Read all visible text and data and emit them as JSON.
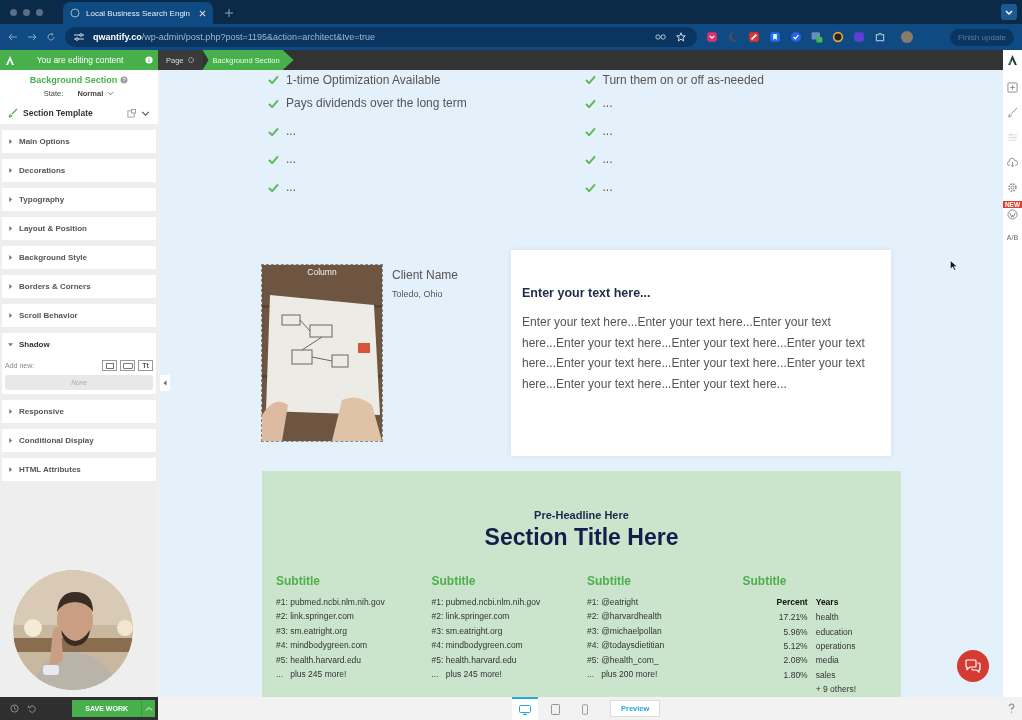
{
  "browser": {
    "tab_title": "Local Business Search Engin",
    "url_domain": "qwantify.co",
    "url_path": "/wp-admin/post.php?post=1195&action=architect&tve=true",
    "finish_update": "Finish update"
  },
  "editor_bar": {
    "notice": "You are editing content",
    "breadcrumbs": [
      "Page",
      "Background Section"
    ]
  },
  "sidebar": {
    "title": "Background Section",
    "state_label": "State:",
    "state_value": "Normal",
    "template": "Section Template",
    "panels": [
      {
        "label": "Main Options",
        "expanded": false
      },
      {
        "label": "Decorations",
        "expanded": false
      },
      {
        "label": "Typography",
        "expanded": false
      },
      {
        "label": "Layout & Position",
        "expanded": false
      },
      {
        "label": "Background Style",
        "expanded": false
      },
      {
        "label": "Borders & Corners",
        "expanded": false
      },
      {
        "label": "Scroll Behavior",
        "expanded": false
      },
      {
        "label": "Shadow",
        "expanded": true,
        "add_new": "Add new:",
        "empty": "None",
        "type_button": "Tt"
      },
      {
        "label": "Responsive",
        "expanded": false
      },
      {
        "label": "Conditional Display",
        "expanded": false
      },
      {
        "label": "HTML Attributes",
        "expanded": false
      }
    ]
  },
  "checklist": {
    "columns": [
      [
        "1-time Optimization Available",
        "Pays dividends over the long term",
        "...",
        "...",
        "..."
      ],
      [
        "Turn them on or off as-needed",
        "...",
        "...",
        "...",
        "..."
      ]
    ]
  },
  "testimonial": {
    "photo_label": "Column",
    "client_name": "Client Name",
    "location": "Toledo, Ohio",
    "heading": "Enter your text here...",
    "body": "Enter your text here...Enter your text here...Enter your text here...Enter your text here...Enter your text here...Enter your text here...Enter your text here...Enter your text here...Enter your text here...Enter your text here...Enter your text here..."
  },
  "section": {
    "pre_headline": "Pre-Headline Here",
    "title": "Section Title Here",
    "columns": [
      {
        "kind": "list",
        "subtitle": "Subtitle",
        "items": [
          "#1: pubmed.ncbi.nlm.nih.gov",
          "#2: link.springer.com",
          "#3: sm.eatright.org",
          "#4: mindbodygreen.com",
          "#5: health.harvard.edu"
        ],
        "more": "...   plus 245 more!"
      },
      {
        "kind": "list",
        "subtitle": "Subtitle",
        "items": [
          "#1: pubmed.ncbi.nlm.nih.gov",
          "#2: link.springer.com",
          "#3: sm.eatright.org",
          "#4: mindbodygreen.com",
          "#5: health.harvard.edu"
        ],
        "more": "...   plus 245 more!"
      },
      {
        "kind": "list",
        "subtitle": "Subtitle",
        "items": [
          "#1: @eatright",
          "#2: @harvardhealth",
          "#3: @michaelpollan",
          "#4: @todaysdietitian",
          "#5: @health_com_"
        ],
        "more": "...   plus 200 more!"
      },
      {
        "kind": "table",
        "subtitle": "Subtitle",
        "headers": [
          "Percent",
          "Years"
        ],
        "rows": [
          [
            "17.21%",
            "health"
          ],
          [
            "5.96%",
            "education"
          ],
          [
            "5.12%",
            "operations"
          ],
          [
            "2.08%",
            "media"
          ],
          [
            "1.80%",
            "sales"
          ]
        ],
        "more": "+ 9 others!"
      }
    ]
  },
  "right_toolbar": {
    "new_badge": "NEW",
    "ab_label": "A/B"
  },
  "bottom_bar": {
    "save": "SAVE WORK",
    "devices": [
      {
        "kind": "desktop",
        "selected": true
      },
      {
        "kind": "tablet",
        "selected": false
      },
      {
        "kind": "phone",
        "selected": false
      }
    ],
    "preview": "Preview"
  }
}
